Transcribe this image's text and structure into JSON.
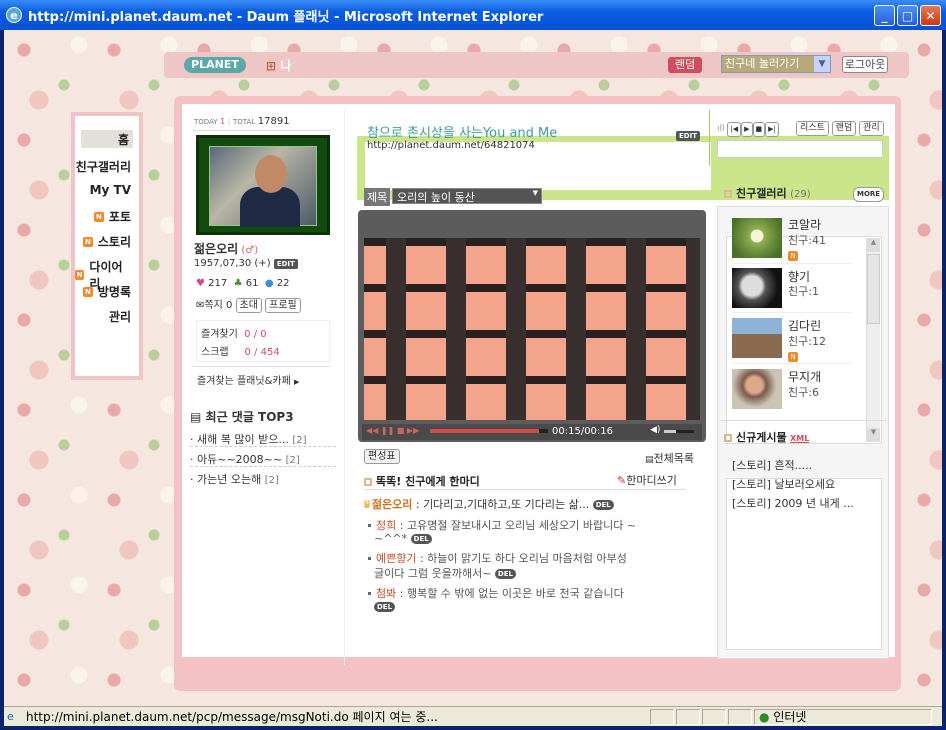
{
  "window": {
    "title": "http://mini.planet.daum.net - Daum 플래닛 - Microsoft Internet Explorer",
    "status_url": "http://mini.planet.daum.net/pcp/message/msgNoti.do 페이지 여는 중...",
    "status_zone": "인터넷"
  },
  "topbar": {
    "logo": "PLANET",
    "me": "나",
    "random": "랜덤",
    "friend_select": "친구네 놀러가기",
    "logout": "로그아웃"
  },
  "nav": {
    "home": "홈",
    "friend_gallery": "친구갤러리",
    "mytv": "My TV",
    "photo": "포토",
    "story": "스토리",
    "diary": "다이어리",
    "guestbook": "방명록",
    "manage": "관리",
    "n_badge": "N"
  },
  "profile": {
    "today_label": "TODAY",
    "today_value": "1",
    "total_label": "TOTAL",
    "total_value": "17891",
    "name": "젊은오리",
    "birthday": "1957,07,30 (+)",
    "edit": "EDIT",
    "hearts": "217",
    "clovers": "61",
    "drops": "22",
    "note_label": "쪽지",
    "note_count": "0",
    "invite": "초대",
    "profile_btn": "프로필",
    "fav_label": "즐겨찾기",
    "fav_value": "0 / 0",
    "scrap_label": "스크랩",
    "scrap_value": "0 / 454",
    "fav_planets": "즐겨찾는 플래닛&카페"
  },
  "recent_comments": {
    "title": "최근 댓글 TOP3",
    "items": [
      {
        "text": "새해 복 많이 받으...",
        "count": "[2]"
      },
      {
        "text": "아듀~~2008~~",
        "count": "[2]"
      },
      {
        "text": "가는년 오는해",
        "count": "[2]"
      }
    ]
  },
  "header": {
    "title": "참으로 존시상을 사는You and Me",
    "url": "http://planet.daum.net/64821074",
    "edit": "EDIT"
  },
  "music": {
    "list": "리스트",
    "random": "랜덤",
    "manage": "관리"
  },
  "player": {
    "title_label": "제목",
    "title_value": "오리의 높이 동산",
    "time": "00:15/00:16",
    "playlist_edit": "편성표",
    "all_list": "전체목록"
  },
  "oneliner": {
    "title": "똑똑! 친구에게 한마디",
    "write": "한마디쓰기",
    "entries": [
      {
        "name": "젊은오리",
        "text": "기다리고,기대하고,또 기다리는 삶...",
        "line2": ""
      },
      {
        "name": "정희",
        "text": "고유명절 잘보내시고 오리님 세상오기 바랍니다 ~",
        "line2": "~^^*"
      },
      {
        "name": "예쁜향기",
        "text": "하늘이 맑기도 하다 오리님 마음처럼 아부성",
        "line2": "글이다 그럼 웃을까해서~"
      },
      {
        "name": "첨봐",
        "text": "행복할 수 밖에 없는 이곳은 바로 천국 같습니다",
        "line2": ""
      }
    ],
    "del": "DEL"
  },
  "friend_gallery": {
    "title": "친구갤러리",
    "count": "(29)",
    "more": "MORE",
    "items": [
      {
        "name": "코알라",
        "friends": "친구:41"
      },
      {
        "name": "향기",
        "friends": "친구:1"
      },
      {
        "name": "김다린",
        "friends": "친구:12"
      },
      {
        "name": "무지개",
        "friends": "친구:6"
      }
    ]
  },
  "new_posts": {
    "title": "신규게시물",
    "xml": "XML",
    "items": [
      "[스토리] 흔적.....",
      "[스토리] 날보러오세요",
      "[스토리] 2009 년 내게 ..."
    ]
  }
}
